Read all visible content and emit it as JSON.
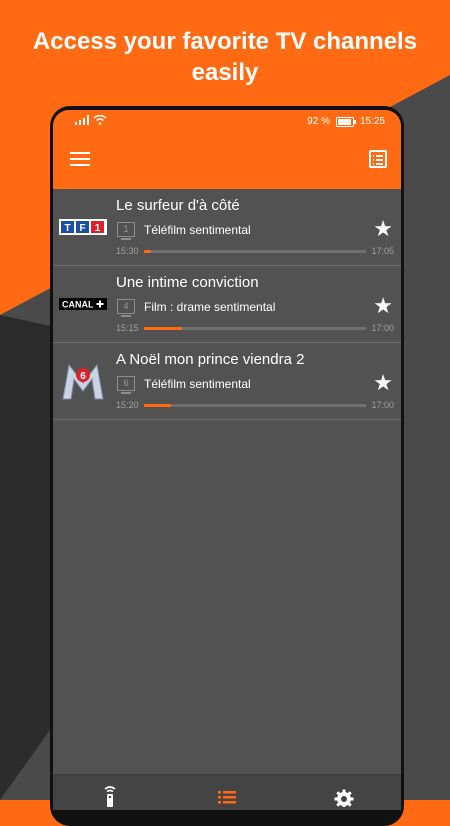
{
  "headline": {
    "line1": "Access your favorite TV channels",
    "line2": "easily"
  },
  "statusbar": {
    "battery": "92 %",
    "time": "15:25",
    "battery_level": 0.92
  },
  "appbar": {
    "menu_icon": "hamburger-menu-icon",
    "guide_icon": "tv-guide-list-icon"
  },
  "programs": [
    {
      "channel": "TF1",
      "channel_number": "1",
      "title": "Le surfeur d'à côté",
      "genre": "Téléfilm sentimental",
      "start": "15:30",
      "end": "17:05",
      "progress": 0.03,
      "favorite": true
    },
    {
      "channel": "CANAL+",
      "channel_number": "4",
      "title": "Une intime conviction",
      "genre": "Film : drame sentimental",
      "start": "15:15",
      "end": "17:00",
      "progress": 0.17,
      "favorite": true
    },
    {
      "channel": "M6",
      "channel_number": "6",
      "title": "A Noël mon prince viendra 2",
      "genre": "Téléfilm sentimental",
      "start": "15:20",
      "end": "17:00",
      "progress": 0.12,
      "favorite": true
    }
  ],
  "bottom_nav": [
    {
      "icon": "remote-icon",
      "active": false
    },
    {
      "icon": "list-icon",
      "active": true
    },
    {
      "icon": "settings-gear-icon",
      "active": false
    }
  ],
  "colors": {
    "accent": "#ff6a13",
    "screen_bg": "#525252",
    "dark_bg": "#3a3a3a"
  }
}
